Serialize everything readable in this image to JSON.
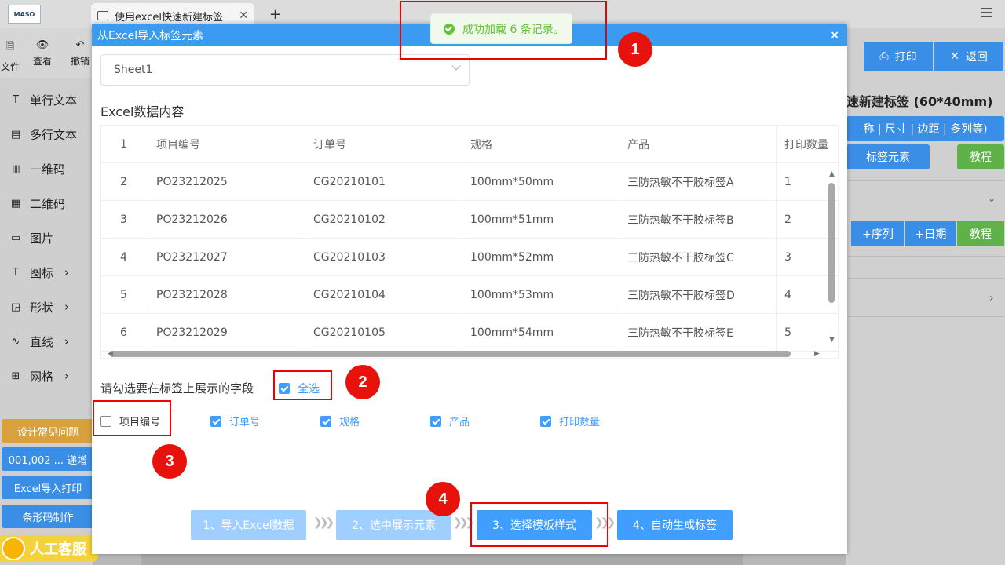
{
  "browser": {
    "tab_title": "使用excel快速新建标签",
    "logo_text": "MASO",
    "close_glyph": "✕",
    "new_tab_glyph": "+"
  },
  "left_toolbar": {
    "file": "文件",
    "view": "查看",
    "undo": "撤销"
  },
  "tools": [
    {
      "label": "单行文本",
      "icon": "T",
      "arrow": false
    },
    {
      "label": "多行文本",
      "icon": "▤",
      "arrow": false
    },
    {
      "label": "一维码",
      "icon": "||||",
      "arrow": false
    },
    {
      "label": "二维码",
      "icon": "▦",
      "arrow": false
    },
    {
      "label": "图片",
      "icon": "▭",
      "arrow": false
    },
    {
      "label": "图标",
      "icon": "T",
      "arrow": true
    },
    {
      "label": "形状",
      "icon": "◲",
      "arrow": true
    },
    {
      "label": "直线",
      "icon": "∿",
      "arrow": true
    },
    {
      "label": "网格",
      "icon": "⊞",
      "arrow": true
    }
  ],
  "left_buttons": [
    "设计常见问题",
    "001,002 ... 递增",
    "Excel导入打印",
    "条形码制作"
  ],
  "kefu": "人工客服",
  "right_panel": {
    "print": "打印",
    "back": "返回",
    "title": "速新建标签 (60*40mm)",
    "size_btn": "称 | 尺寸 | 边距 | 多列等)",
    "elem_btn": "标签元素",
    "tutorial": "教程",
    "seq": "+序列",
    "date": "+日期",
    "tutorial2": "教程"
  },
  "modal": {
    "title": "从Excel导入标签元素",
    "close": "×",
    "sheet_value": "Sheet1",
    "section_title": "Excel数据内容",
    "table": {
      "header": [
        "1",
        "项目编号",
        "订单号",
        "规格",
        "产品",
        "打印数量"
      ],
      "rows": [
        [
          "2",
          "PO23212025",
          "CG20210101",
          "100mm*50mm",
          "三防热敏不干胶标签A",
          "1"
        ],
        [
          "3",
          "PO23212026",
          "CG20210102",
          "100mm*51mm",
          "三防热敏不干胶标签B",
          "2"
        ],
        [
          "4",
          "PO23212027",
          "CG20210103",
          "100mm*52mm",
          "三防热敏不干胶标签C",
          "3"
        ],
        [
          "5",
          "PO23212028",
          "CG20210104",
          "100mm*53mm",
          "三防热敏不干胶标签D",
          "4"
        ],
        [
          "6",
          "PO23212029",
          "CG20210105",
          "100mm*54mm",
          "三防热敏不干胶标签E",
          "5"
        ]
      ]
    },
    "prompt": "请勾选要在标签上展示的字段",
    "select_all": "全选",
    "fields": [
      {
        "label": "项目编号",
        "checked": false
      },
      {
        "label": "订单号",
        "checked": true
      },
      {
        "label": "规格",
        "checked": true
      },
      {
        "label": "产品",
        "checked": true
      },
      {
        "label": "打印数量",
        "checked": true
      }
    ],
    "steps": [
      "1、导入Excel数据",
      "2、选中展示元素",
      "3、选择模板样式",
      "4、自动生成标签"
    ]
  },
  "toast": "成功加载 6 条记录。",
  "annotations": [
    "1",
    "2",
    "3",
    "4"
  ],
  "colors": {
    "primary": "#409eff",
    "header": "#3a9bf0",
    "success": "#67c23a",
    "tutorial": "#5fb14a",
    "faq": "#d8a13e",
    "annotation": "#e8120c",
    "kefu": "#f5d23a"
  }
}
